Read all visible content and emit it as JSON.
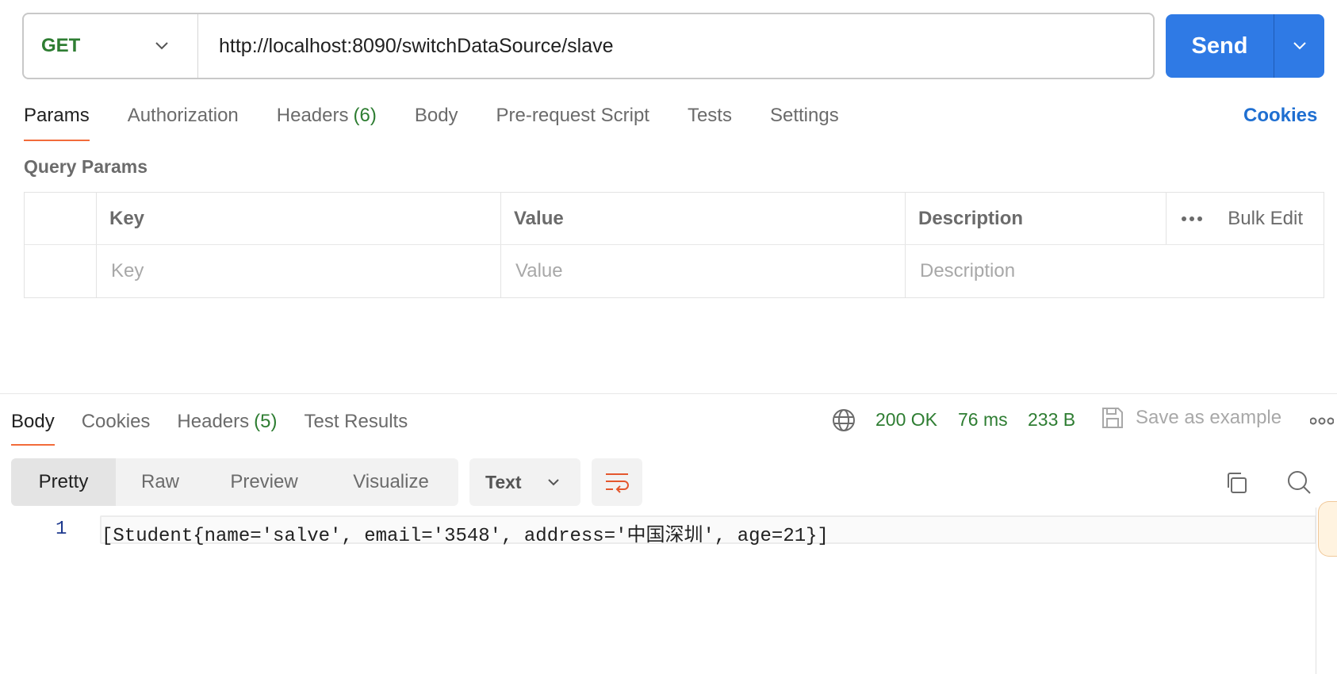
{
  "request": {
    "method": "GET",
    "url": "http://localhost:8090/switchDataSource/slave",
    "send_label": "Send"
  },
  "request_tabs": [
    {
      "label": "Params",
      "count": "",
      "active": true
    },
    {
      "label": "Authorization",
      "count": ""
    },
    {
      "label": "Headers",
      "count": "(6)"
    },
    {
      "label": "Body",
      "count": ""
    },
    {
      "label": "Pre-request Script",
      "count": ""
    },
    {
      "label": "Tests",
      "count": ""
    },
    {
      "label": "Settings",
      "count": ""
    }
  ],
  "cookies_link": "Cookies",
  "query_params": {
    "title": "Query Params",
    "headers": {
      "key": "Key",
      "value": "Value",
      "description": "Description",
      "bulk_edit": "Bulk Edit"
    },
    "placeholders": {
      "key": "Key",
      "value": "Value",
      "description": "Description"
    }
  },
  "response": {
    "tabs": [
      {
        "label": "Body",
        "count": "",
        "active": true
      },
      {
        "label": "Cookies",
        "count": ""
      },
      {
        "label": "Headers",
        "count": "(5)"
      },
      {
        "label": "Test Results",
        "count": ""
      }
    ],
    "status": "200 OK",
    "time": "76 ms",
    "size": "233 B",
    "save_example": "Save as example",
    "view_modes": [
      "Pretty",
      "Raw",
      "Preview",
      "Visualize"
    ],
    "format": "Text",
    "lines": [
      {
        "no": "1",
        "text": "[Student{name='salve', email='3548', address='中国深圳', age=21}]"
      }
    ]
  },
  "colors": {
    "accent": "#2f7ae5",
    "success": "#2e7d32",
    "tab_indicator": "#f26b3a",
    "link": "#1f6fd1"
  }
}
